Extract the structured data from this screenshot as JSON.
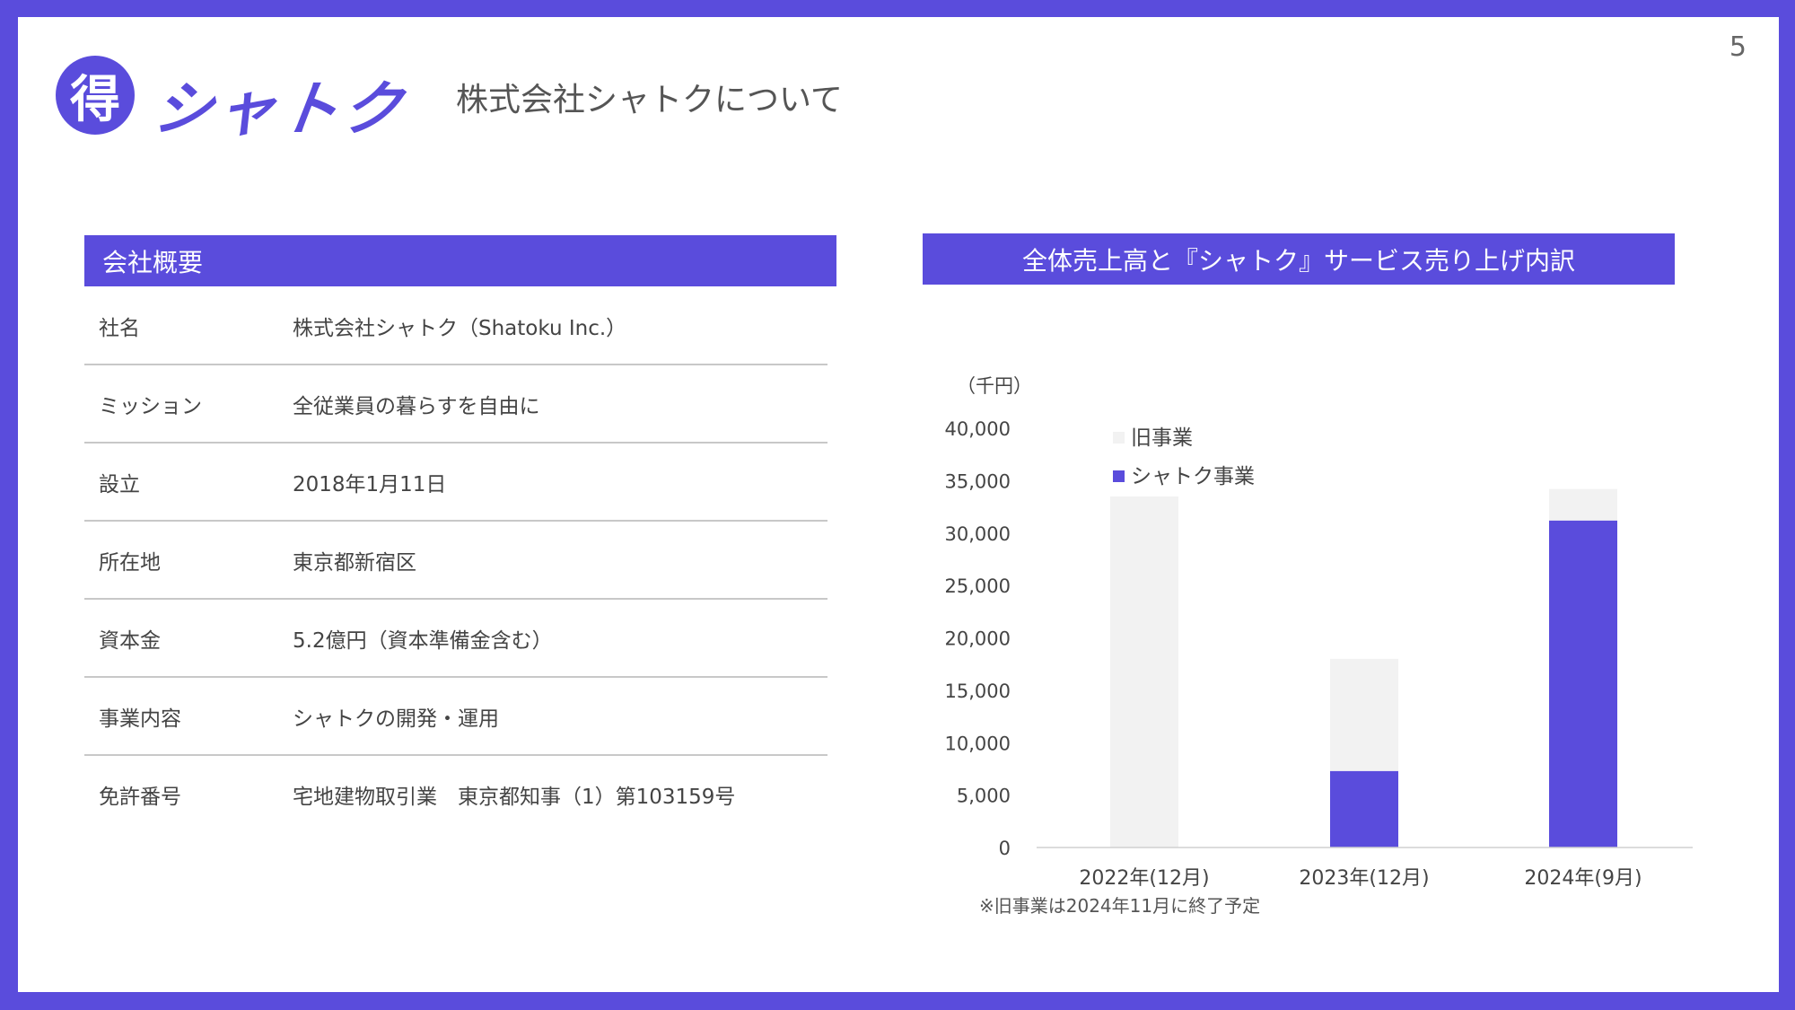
{
  "page_number": "5",
  "logo": {
    "badge": "得",
    "wordmark": "シャトク"
  },
  "header_title": "株式会社シャトクについて",
  "company_panel": {
    "title": "会社概要",
    "rows": [
      {
        "label": "社名",
        "value": "株式会社シャトク（Shatoku Inc.）"
      },
      {
        "label": "ミッション",
        "value": "全従業員の暮らすを自由に"
      },
      {
        "label": "設立",
        "value": "2018年1月11日"
      },
      {
        "label": "所在地",
        "value": "東京都新宿区"
      },
      {
        "label": "資本金",
        "value": "5.2億円（資本準備金含む）"
      },
      {
        "label": "事業内容",
        "value": "シャトクの開発・運用"
      },
      {
        "label": "免許番号",
        "value": "宅地建物取引業　東京都知事（1）第103159号"
      }
    ]
  },
  "chart_panel": {
    "title": "全体売上高と『シャトク』サービス売り上げ内訳",
    "footnote": "※旧事業は2024年11月に終了予定"
  },
  "colors": {
    "brand": "#5a4cdc",
    "old_business": "#f2f2f2",
    "shatoku_business": "#5a4cdc"
  },
  "chart_data": {
    "type": "bar",
    "stacked": true,
    "unit_label": "（千円）",
    "categories": [
      "2022年(12月)",
      "2023年(12月)",
      "2024年(9月)"
    ],
    "series": [
      {
        "name": "シャトク事業",
        "values": [
          0,
          7300,
          31200
        ]
      },
      {
        "name": "旧事業",
        "values": [
          33500,
          10700,
          3000
        ]
      }
    ],
    "ylim": [
      0,
      40000
    ],
    "yticks": [
      0,
      5000,
      10000,
      15000,
      20000,
      25000,
      30000,
      35000,
      40000
    ],
    "ytick_labels": [
      "0",
      "5,000",
      "10,000",
      "15,000",
      "20,000",
      "25,000",
      "30,000",
      "35,000",
      "40,000"
    ],
    "legend_position": "top-left",
    "grid": false
  }
}
